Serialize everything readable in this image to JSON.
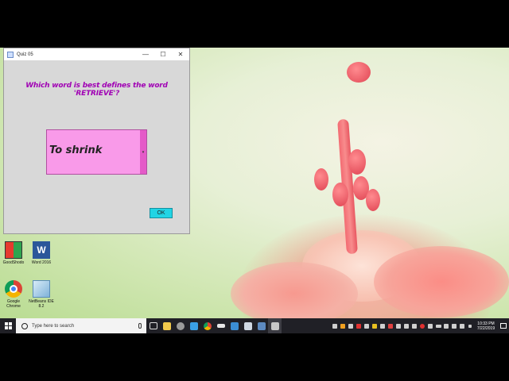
{
  "window": {
    "title": "Quiz 05",
    "minimize_glyph": "—",
    "maximize_glyph": "☐",
    "close_glyph": "✕",
    "question": "Which word is best defines the word 'RETRIEVE'?",
    "answer_combo": {
      "selected": "To shrink",
      "arrow_glyph": "▾"
    },
    "ok_label": "OK"
  },
  "desktop_icons": [
    {
      "label": "GoodShodo",
      "icon": "app-icon"
    },
    {
      "label": "Word 2016",
      "icon": "word-icon"
    },
    {
      "label": "Google Chrome",
      "icon": "chrome-icon"
    },
    {
      "label": "NetBeans IDE 8.2",
      "icon": "netbeans-icon"
    }
  ],
  "taskbar": {
    "search_placeholder": "Type here to search",
    "apps": [
      "task-view-icon",
      "file-explorer-icon",
      "edge-icon",
      "chrome-icon",
      "media-icon",
      "store-icon",
      "outlook-icon",
      "netbeans-icon",
      "java-app-icon"
    ],
    "clock_time": "10:33 PM",
    "clock_date": "7/22/2019"
  },
  "colors": {
    "question_text": "#a000b4",
    "combo_bg": "#f99ae9",
    "ok_bg": "#22d4e4",
    "taskbar": "#202026"
  }
}
